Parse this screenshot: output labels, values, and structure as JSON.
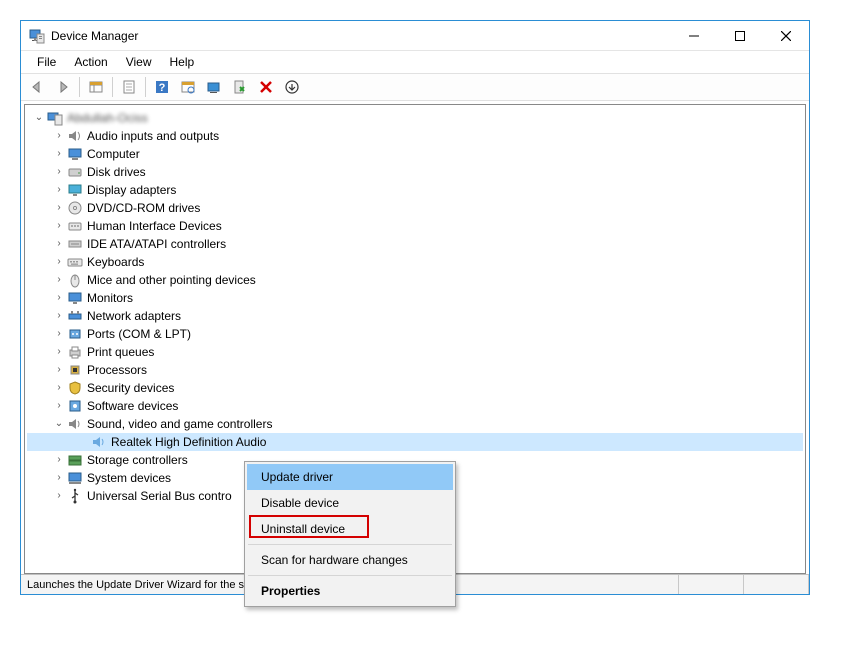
{
  "window": {
    "title": "Device Manager"
  },
  "menubar": {
    "file": "File",
    "action": "Action",
    "view": "View",
    "help": "Help"
  },
  "tree": {
    "root": "Abdullah-Ociss",
    "nodes": [
      {
        "label": "Audio inputs and outputs",
        "icon": "audio"
      },
      {
        "label": "Computer",
        "icon": "computer"
      },
      {
        "label": "Disk drives",
        "icon": "disk"
      },
      {
        "label": "Display adapters",
        "icon": "display"
      },
      {
        "label": "DVD/CD-ROM drives",
        "icon": "dvd"
      },
      {
        "label": "Human Interface Devices",
        "icon": "hid"
      },
      {
        "label": "IDE ATA/ATAPI controllers",
        "icon": "ide"
      },
      {
        "label": "Keyboards",
        "icon": "keyboard"
      },
      {
        "label": "Mice and other pointing devices",
        "icon": "mouse"
      },
      {
        "label": "Monitors",
        "icon": "monitor"
      },
      {
        "label": "Network adapters",
        "icon": "network"
      },
      {
        "label": "Ports (COM & LPT)",
        "icon": "ports"
      },
      {
        "label": "Print queues",
        "icon": "printer"
      },
      {
        "label": "Processors",
        "icon": "cpu"
      },
      {
        "label": "Security devices",
        "icon": "security"
      },
      {
        "label": "Software devices",
        "icon": "software"
      }
    ],
    "svgc": {
      "label": "Sound, video and game controllers",
      "icon": "sound"
    },
    "svgc_child": {
      "label": "Realtek High Definition Audio",
      "icon": "speaker"
    },
    "after": [
      {
        "label": "Storage controllers",
        "icon": "storage"
      },
      {
        "label": "System devices",
        "icon": "system"
      },
      {
        "label": "Universal Serial Bus controllers",
        "icon": "usb"
      }
    ]
  },
  "context_menu": {
    "update": "Update driver",
    "disable": "Disable device",
    "uninstall": "Uninstall device",
    "scan": "Scan for hardware changes",
    "properties": "Properties"
  },
  "statusbar": {
    "text": "Launches the Update Driver Wizard for the selected device."
  }
}
